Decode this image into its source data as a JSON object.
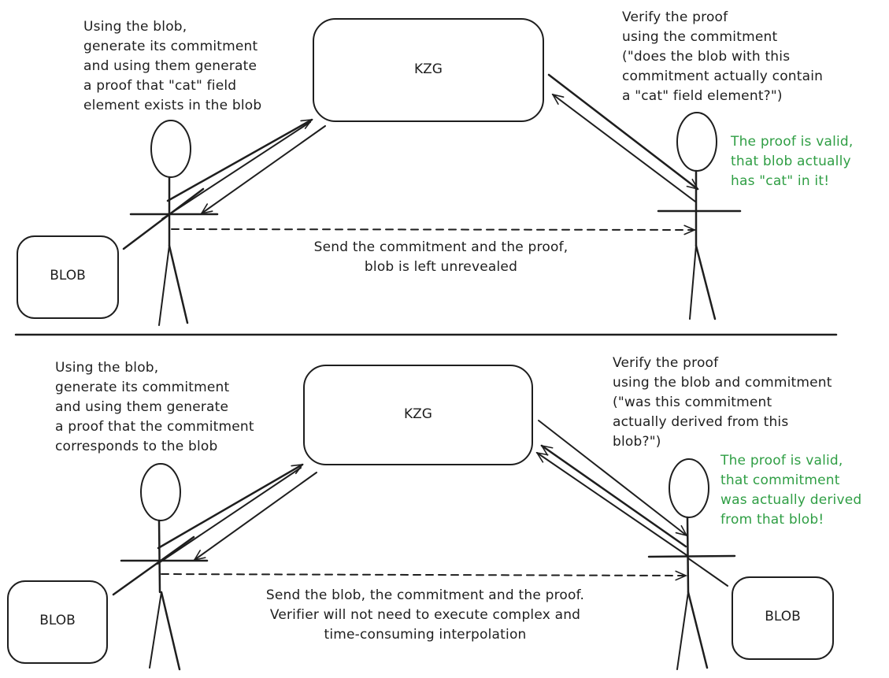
{
  "colors": {
    "ink": "#1e1e1e",
    "success": "#2f9e44",
    "background": "#ffffff"
  },
  "top_scenario": {
    "kzg_label": "KZG",
    "blob_label": "BLOB",
    "prover_note": "Using the blob,\ngenerate its commitment\nand using them generate\na proof that \"cat\" field\nelement exists in the blob",
    "verifier_note": "Verify the proof\nusing the commitment\n(\"does the blob with this\ncommitment actually contain\na \"cat\" field element?\")",
    "result_note": "The proof is valid,\nthat blob actually\nhas \"cat\" in it!",
    "transfer_note": "Send the commitment and the proof,\nblob is left unrevealed"
  },
  "bottom_scenario": {
    "kzg_label": "KZG",
    "prover_blob_label": "BLOB",
    "verifier_blob_label": "BLOB",
    "prover_note": "Using the blob,\ngenerate its commitment\nand using them generate\na proof that the commitment\ncorresponds to the blob",
    "verifier_note": "Verify the proof\nusing the blob and commitment\n(\"was this commitment\nactually derived from this\nblob?\")",
    "result_note": "The proof is valid,\nthat commitment\nwas actually derived\nfrom that blob!",
    "transfer_note": "Send the blob, the commitment and the proof.\nVerifier will not need to execute complex and\ntime-consuming interpolation"
  }
}
